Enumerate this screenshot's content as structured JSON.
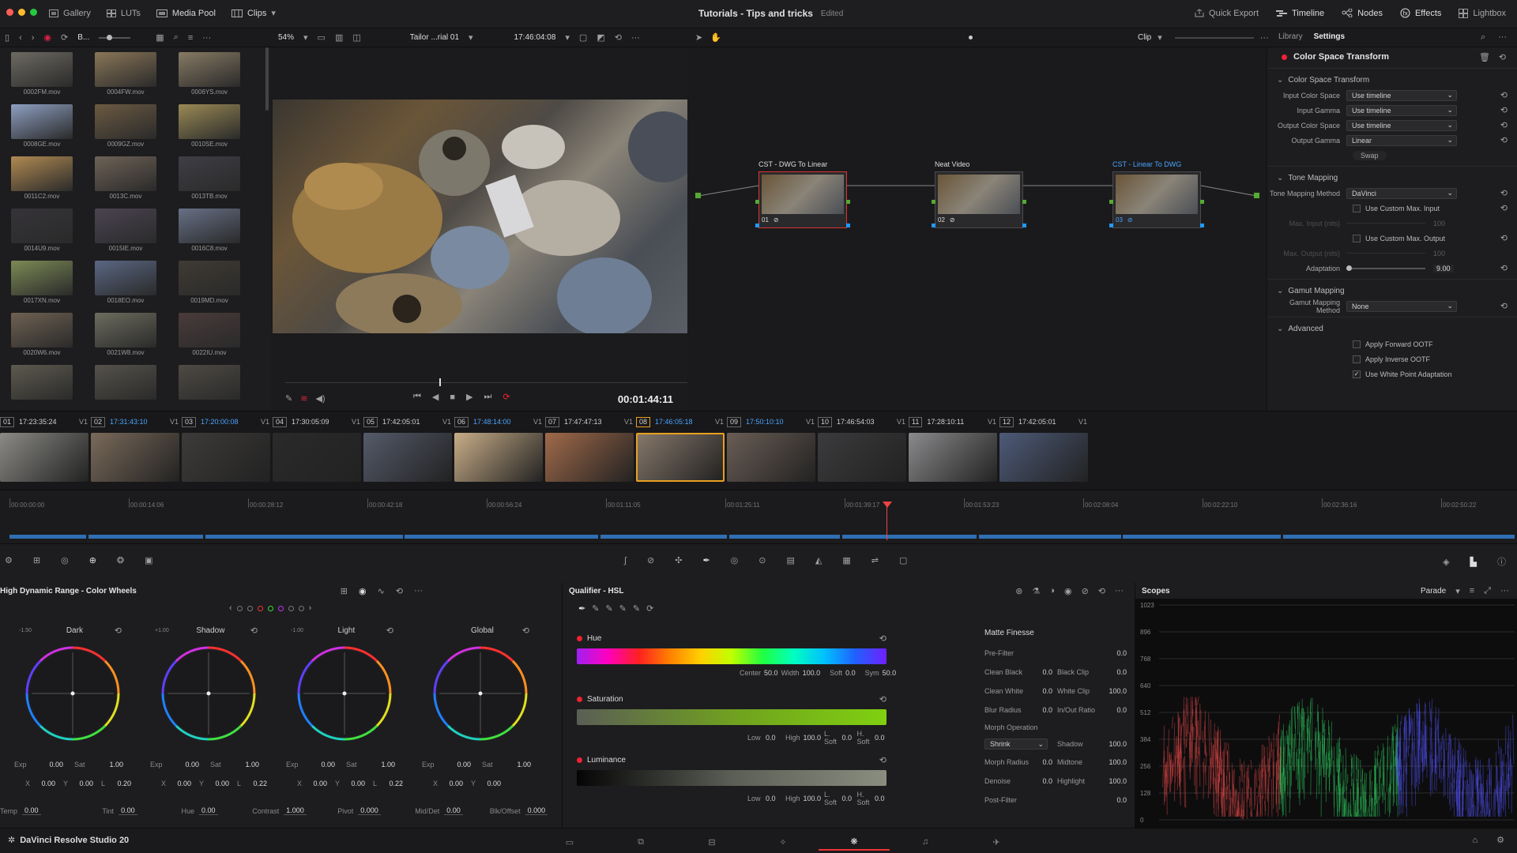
{
  "titlebar": {
    "tabs": [
      {
        "label": "Gallery",
        "icon": "gallery-icon"
      },
      {
        "label": "LUTs",
        "icon": "luts-icon"
      },
      {
        "label": "Media Pool",
        "icon": "media-pool-icon"
      },
      {
        "label": "Clips",
        "icon": "clips-icon"
      }
    ],
    "project_title": "Tutorials - Tips and tricks",
    "status": "Edited",
    "right_buttons": [
      {
        "label": "Quick Export",
        "icon": "quick-export-icon"
      },
      {
        "label": "Timeline",
        "icon": "timeline-icon"
      },
      {
        "label": "Nodes",
        "icon": "nodes-icon"
      },
      {
        "label": "Effects",
        "icon": "effects-icon"
      },
      {
        "label": "Lightbox",
        "icon": "lightbox-icon"
      }
    ]
  },
  "toolbar": {
    "bin_label": "B...",
    "zoom": "54%",
    "timeline_name": "Tailor ...rial 01",
    "timecode": "17:46:04:08",
    "node_mode": "Clip",
    "tabs": [
      "Library",
      "Settings"
    ]
  },
  "media": [
    {
      "name": "0002FM.mov",
      "color": "#6d6a62"
    },
    {
      "name": "0004FW.mov",
      "color": "#8a7658"
    },
    {
      "name": "0006YS.mov",
      "color": "#877a64"
    },
    {
      "name": "0008GE.mov",
      "color": "#8e9fc1"
    },
    {
      "name": "0009GZ.mov",
      "color": "#6b5a42"
    },
    {
      "name": "0010SE.mov",
      "color": "#9a8a55"
    },
    {
      "name": "0011C2.mov",
      "color": "#b08a52"
    },
    {
      "name": "0013C.mov",
      "color": "#6e6256"
    },
    {
      "name": "0013TB.mov",
      "color": "#3f3e45"
    },
    {
      "name": "0014U9.mov",
      "color": "#353338"
    },
    {
      "name": "0015IE.mov",
      "color": "#4b4451"
    },
    {
      "name": "0016C8.mov",
      "color": "#677086"
    },
    {
      "name": "0017XN.mov",
      "color": "#7c8a55"
    },
    {
      "name": "0018EO.mov",
      "color": "#5a6783"
    },
    {
      "name": "0019MD.mov",
      "color": "#3f3a33"
    },
    {
      "name": "0020W6.mov",
      "color": "#6f6152"
    },
    {
      "name": "0021W8.mov",
      "color": "#6d6c5e"
    },
    {
      "name": "0022IU.mov",
      "color": "#4a3b3b"
    },
    {
      "name": "",
      "color": "#5d5a4e"
    },
    {
      "name": "",
      "color": "#55524a"
    },
    {
      "name": "",
      "color": "#4e4a44"
    }
  ],
  "viewer": {
    "timecode": "00:01:44:11"
  },
  "nodes": [
    {
      "label": "CST - DWG To Linear",
      "num": "01"
    },
    {
      "label": "Neat Video",
      "num": "02"
    },
    {
      "label": "CST - Linear To DWG",
      "num": "03"
    }
  ],
  "settings": {
    "effect_title": "Color Space Transform",
    "section_cst": "Color Space Transform",
    "input_color_space_label": "Input Color Space",
    "input_color_space": "Use timeline",
    "input_gamma_label": "Input Gamma",
    "input_gamma": "Use timeline",
    "output_color_space_label": "Output Color Space",
    "output_color_space": "Use timeline",
    "output_gamma_label": "Output Gamma",
    "output_gamma": "Linear",
    "swap": "Swap",
    "section_tone": "Tone Mapping",
    "tone_method_label": "Tone Mapping Method",
    "tone_method": "DaVinci",
    "custom_max_input": "Use Custom Max. Input",
    "max_input_label": "Max. Input (nits)",
    "max_input": "100",
    "custom_max_output": "Use Custom Max. Output",
    "max_output_label": "Max. Output (nits)",
    "max_output": "100",
    "adaptation_label": "Adaptation",
    "adaptation": "9.00",
    "section_gamut": "Gamut Mapping",
    "gamut_method_label": "Gamut Mapping Method",
    "gamut_method": "None",
    "section_advanced": "Advanced",
    "apply_forward": "Apply Forward OOTF",
    "apply_inverse": "Apply Inverse OOTF",
    "white_point": "Use White Point Adaptation"
  },
  "clips": [
    {
      "num": "01",
      "tc": "17:23:35:24",
      "track": "V1",
      "color": "#8b8a86",
      "active": false
    },
    {
      "num": "02",
      "tc": "17:31:43:10",
      "track": "V1",
      "color": "#7a6a5a",
      "active": false
    },
    {
      "num": "03",
      "tc": "17:20:00:08",
      "track": "V1",
      "color": "#3d3b39",
      "active": false
    },
    {
      "num": "04",
      "tc": "17:30:05:09",
      "track": "V1",
      "color": "#2a2a2a",
      "active": false
    },
    {
      "num": "05",
      "tc": "17:42:05:01",
      "track": "V1",
      "color": "#555a6a",
      "active": false
    },
    {
      "num": "06",
      "tc": "17:48:14:00",
      "track": "V1",
      "color": "#c8ad88",
      "active": false
    },
    {
      "num": "07",
      "tc": "17:47:47:13",
      "track": "V1",
      "color": "#a06a4a",
      "active": false
    },
    {
      "num": "08",
      "tc": "17:46:05:18",
      "track": "V1",
      "color": "#85776a",
      "active": true
    },
    {
      "num": "09",
      "tc": "17:50:10:10",
      "track": "V1",
      "color": "#6a5d55",
      "active": false
    },
    {
      "num": "10",
      "tc": "17:46:54:03",
      "track": "V1",
      "color": "#3b3b3d",
      "active": false
    },
    {
      "num": "11",
      "tc": "17:28:10:11",
      "track": "V1",
      "color": "#8a8a8c",
      "active": false
    },
    {
      "num": "12",
      "tc": "17:42:05:01",
      "track": "V1",
      "color": "#4d5a78",
      "active": false
    }
  ],
  "ruler": [
    "00:00:00:00",
    "00:00:14:06",
    "00:00:28:12",
    "00:00:42:18",
    "00:00:56:24",
    "00:01:11:05",
    "00:01:25:11",
    "00:01:39:17",
    "00:01:53:23",
    "00:02:08:04",
    "00:02:22:10",
    "00:02:36:16",
    "00:02:50:22"
  ],
  "wheels": {
    "title": "High Dynamic Range - Color Wheels",
    "items": [
      {
        "name": "Dark",
        "zone": "-1.50",
        "exp": "0.00",
        "sat": "1.00",
        "x": "0.00",
        "y": "0.00",
        "z": "0.20",
        "zlabel": "L"
      },
      {
        "name": "Shadow",
        "zone": "+1.00",
        "exp": "0.00",
        "sat": "1.00",
        "x": "0.00",
        "y": "0.00",
        "z": "0.22",
        "zlabel": "L"
      },
      {
        "name": "Light",
        "zone": "-1.00",
        "exp": "0.00",
        "sat": "1.00",
        "x": "0.00",
        "y": "0.00",
        "z": "0.22",
        "zlabel": "L"
      },
      {
        "name": "Global",
        "zone": "",
        "exp": "0.00",
        "sat": "1.00",
        "x": "0.00",
        "y": "0.00",
        "z": "",
        "zlabel": ""
      }
    ],
    "labels": {
      "exp": "Exp",
      "sat": "Sat",
      "x": "X",
      "y": "Y"
    },
    "bottom": [
      {
        "label": "Temp",
        "value": "0.00"
      },
      {
        "label": "Tint",
        "value": "0.00"
      },
      {
        "label": "Hue",
        "value": "0.00"
      },
      {
        "label": "Contrast",
        "value": "1.000"
      },
      {
        "label": "Pivot",
        "value": "0.000"
      },
      {
        "label": "Mid/Det",
        "value": "0.00"
      },
      {
        "label": "Blk/Offset",
        "value": "0.000"
      }
    ]
  },
  "qualifier": {
    "title": "Qualifier - HSL",
    "hue": {
      "label": "Hue",
      "center_l": "Center",
      "center": "50.0",
      "width_l": "Width",
      "width": "100.0",
      "soft_l": "Soft",
      "soft": "0.0",
      "sym_l": "Sym",
      "sym": "50.0"
    },
    "sat": {
      "label": "Saturation",
      "low_l": "Low",
      "low": "0.0",
      "high_l": "High",
      "high": "100.0",
      "lsoft_l": "L. Soft",
      "lsoft": "0.0",
      "hsoft_l": "H. Soft",
      "hsoft": "0.0"
    },
    "lum": {
      "label": "Luminance",
      "low_l": "Low",
      "low": "0.0",
      "high_l": "High",
      "high": "100.0",
      "lsoft_l": "L. Soft",
      "lsoft": "0.0",
      "hsoft_l": "H. Soft",
      "hsoft": "0.0"
    }
  },
  "matte": {
    "title": "Matte Finesse",
    "pre_filter_l": "Pre-Filter",
    "pre_filter": "0.0",
    "clean_black_l": "Clean Black",
    "clean_black": "0.0",
    "black_clip_l": "Black Clip",
    "black_clip": "0.0",
    "clean_white_l": "Clean White",
    "clean_white": "0.0",
    "white_clip_l": "White Clip",
    "white_clip": "100.0",
    "blur_radius_l": "Blur Radius",
    "blur_radius": "0.0",
    "inout_ratio_l": "In/Out Ratio",
    "inout_ratio": "0.0",
    "morph_op_l": "Morph Operation",
    "morph_op": "Shrink",
    "shadow_l": "Shadow",
    "shadow": "100.0",
    "morph_radius_l": "Morph Radius",
    "morph_radius": "0.0",
    "midtone_l": "Midtone",
    "midtone": "100.0",
    "denoise_l": "Denoise",
    "denoise": "0.0",
    "highlight_l": "Highlight",
    "highlight": "100.0",
    "post_filter_l": "Post-Filter",
    "post_filter": "0.0"
  },
  "scopes": {
    "title": "Scopes",
    "mode": "Parade",
    "scale": [
      "1023",
      "896",
      "768",
      "640",
      "512",
      "384",
      "256",
      "128",
      "0"
    ]
  },
  "footer": {
    "app_name": "DaVinci Resolve Studio 20"
  }
}
